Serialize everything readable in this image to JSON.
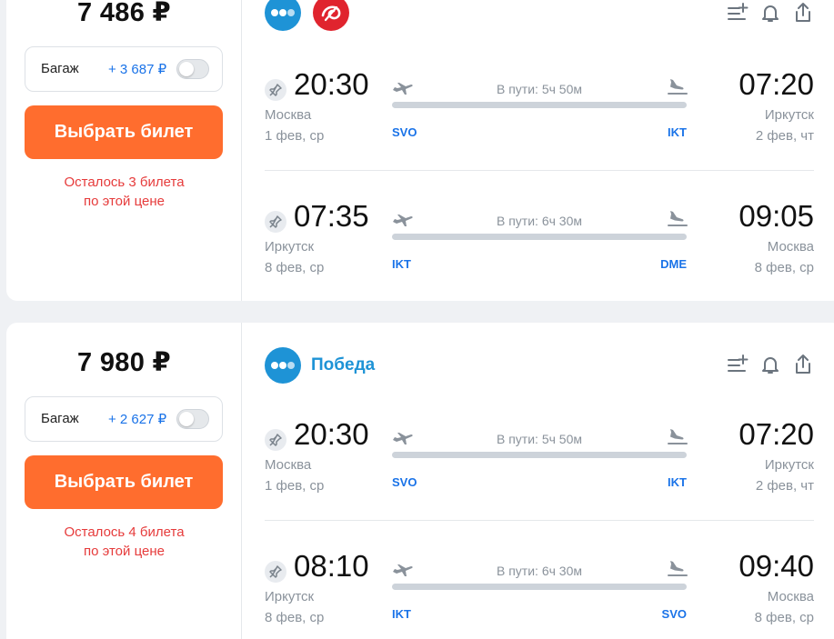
{
  "cards": [
    {
      "price": "7 486 ₽",
      "baggage_label": "Багаж",
      "baggage_price": "+ 3 687 ₽",
      "button": "Выбрать билет",
      "note_line1": "Осталось 3 билета",
      "note_line2": "по этой цене",
      "airline_name": "",
      "segments": [
        {
          "dep_time": "20:30",
          "dep_city": "Москва",
          "dep_date": "1 фев, ср",
          "duration": "В пути: 5ч 50м",
          "dep_code": "SVO",
          "arr_code": "IKT",
          "arr_time": "07:20",
          "arr_city": "Иркутск",
          "arr_date": "2 фев, чт"
        },
        {
          "dep_time": "07:35",
          "dep_city": "Иркутск",
          "dep_date": "8 фев, ср",
          "duration": "В пути: 6ч 30м",
          "dep_code": "IKT",
          "arr_code": "DME",
          "arr_time": "09:05",
          "arr_city": "Москва",
          "arr_date": "8 фев, ср"
        }
      ]
    },
    {
      "price": "7 980 ₽",
      "baggage_label": "Багаж",
      "baggage_price": "+ 2 627 ₽",
      "button": "Выбрать билет",
      "note_line1": "Осталось 4 билета",
      "note_line2": "по этой цене",
      "airline_name": "Победа",
      "segments": [
        {
          "dep_time": "20:30",
          "dep_city": "Москва",
          "dep_date": "1 фев, ср",
          "duration": "В пути: 5ч 50м",
          "dep_code": "SVO",
          "arr_code": "IKT",
          "arr_time": "07:20",
          "arr_city": "Иркутск",
          "arr_date": "2 фев, чт"
        },
        {
          "dep_time": "08:10",
          "dep_city": "Иркутск",
          "dep_date": "8 фев, ср",
          "duration": "В пути: 6ч 30м",
          "dep_code": "IKT",
          "arr_code": "SVO",
          "arr_time": "09:40",
          "arr_city": "Москва",
          "arr_date": "8 фев, ср"
        }
      ]
    }
  ],
  "icons": [
    "pobeda-logo-icon",
    "s7-logo-icon",
    "add-to-list-icon",
    "bell-icon",
    "share-icon",
    "pin-icon",
    "takeoff-plane-icon",
    "landing-plane-icon",
    "toggle-switch"
  ],
  "colors": {
    "accent_orange": "#ff6d2e",
    "link_blue": "#1a73e8",
    "warning_red": "#e63b3b",
    "pobeda_blue": "#1e93d6"
  }
}
